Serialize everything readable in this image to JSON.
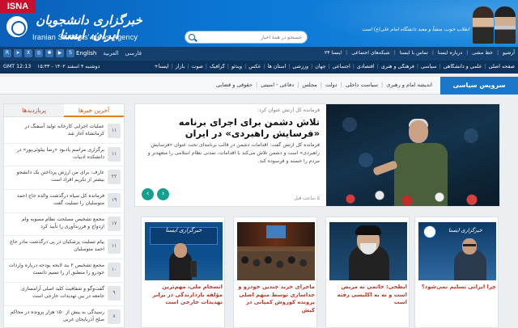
{
  "header": {
    "isna_tab": "ISNA",
    "logo_fa": "خبرگزاری دانشجویان ایران، ایسنا",
    "logo_en": "Iranian Students' News Agency",
    "quote": "انقلاب خوب، منشأ و معبد دانشگاه امام علی(ع) است",
    "search_placeholder": "جستجو در همهٔ اخبار"
  },
  "toolbar": {
    "social_icons": [
      "rss-icon",
      "telegram-icon",
      "twitter-icon",
      "instagram-icon",
      "aparat-icon",
      "youtube-icon",
      "soroush-icon",
      "bale-icon",
      "eitaa-icon"
    ],
    "languages": [
      "English",
      "العربية",
      "فارسی"
    ],
    "current_language": "English",
    "top_links": [
      "آرشیو",
      "خط مشی",
      "درباره ایسنا",
      "تماس با ایسنا",
      "شبکه‌های اجتماعی",
      "ایسنا ۲۴"
    ]
  },
  "datebar": {
    "gmt": "GMT 12:13",
    "date": "دوشنبه ۴ اسفند ۱۴۰۲ - ۱۵:۴۳"
  },
  "categories": [
    "صفحه اصلی",
    "علمی و دانشگاهی",
    "سیاسی",
    "فرهنگی و هنری",
    "اقتصادی",
    "اجتماعی",
    "جهان",
    "ورزشی",
    "استان ها",
    "عکس",
    "ویدئو",
    "گرافیک",
    "صوت",
    "بازار",
    "ایسنا+"
  ],
  "service": {
    "title": "سرویس سیاسی",
    "links": [
      "اندیشه امام و رهبری",
      "سیاست داخلی",
      "دولت",
      "مجلس",
      "دفاعی - امنیتی",
      "حقوقی و قضایی"
    ]
  },
  "sidebar": {
    "tabs": [
      "آخرین خبرها",
      "پربازدیدها"
    ],
    "active_tab": "آخرین خبرها",
    "items": [
      {
        "num": "۱۱",
        "text": "عملیات اجرایی کارخانه تولید آسفنگ در کرمانشاه آغاز شد"
      },
      {
        "num": "۱۱",
        "text": "برگزاری مراسم یادبود «رضا بیلوئی‌پور» در دانشکده ادبیات"
      },
      {
        "num": "۲۲",
        "text": "عارف: برای من ارزش پرداختن یک دانشجو بیشتر از تکریم افراد است"
      },
      {
        "num": "۱۹",
        "text": "فرمانده کل سپاه درگذشت والده حاج احمد متوسلیان را تسلیت گفت"
      },
      {
        "num": "۱۷",
        "text": "مجمع تشخیص مصلحت نظام مصوبه وام ازدواج و فرزندآوری را تأیید کرد"
      },
      {
        "num": "۱۱",
        "text": "پیام تسلیت پزشکیان در پی درگذشت مادر حاج احمد متوسلیان"
      },
      {
        "num": "۱۰",
        "text": "مجمع تشخیص ۲ بند لایحه بودجه درباره واردات خودرو را منطبق از را تسیم دانست"
      },
      {
        "num": "۹",
        "text": "گفت‌وگو و شفافیت کلید اصلی آرامسازی جامعه در بین تهدیدات خارجی است"
      },
      {
        "num": "۸",
        "text": "رسیدگی به بیش از ۱۵۰ هزار پرونده در محاکم صلح آذربایجان غربی"
      }
    ]
  },
  "featured": {
    "kicker": "فرمانده کل ارتش عنوان کرد:",
    "title": "تلاش دشمن برای اجرای برنامه «فرسایش راهبردی» در ایران",
    "lead": "فرمانده کل ارتش گفت: اقدامات دشمن در قالب برنامه‌ای تحت عنوان «فرسایش راهبردی» است و دشمن تلاش می‌کند با اقدامات، تمدنی نظام اسلامی را متعهد‌تر و مردم را خسته و فرسوده کند.",
    "time": "۵ ساعت قبل"
  },
  "cards": [
    {
      "caption": "انسجام ملی، مهم‌ترین مؤلفه بازدارندگی در برابر تهدیدات خارجی است"
    },
    {
      "caption": "ماجرای خرید چندین خودرو و جداسازی توسط منهم اصلی پرونده کوروش کمپانی در کیش"
    },
    {
      "caption": "ابطحی: خاتمی نه مریض است و نه به اکلیسی رفته است"
    },
    {
      "caption": "چرا ایرانی تسلیم نمی‌شود؟"
    }
  ]
}
